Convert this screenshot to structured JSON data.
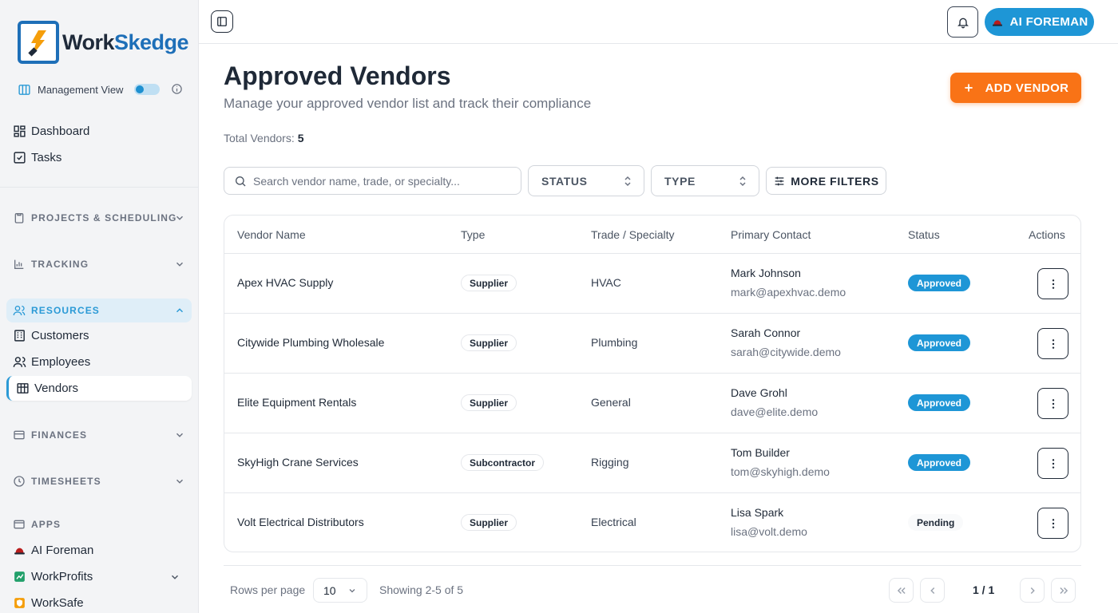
{
  "brand": {
    "name_part1": "Work",
    "name_part2": "Skedge"
  },
  "sidebar": {
    "management_view": "Management View",
    "top_items": [
      {
        "label": "Dashboard"
      },
      {
        "label": "Tasks"
      }
    ],
    "sections": {
      "projects": "PROJECTS & SCHEDULING",
      "tracking": "TRACKING",
      "resources": "RESOURCES",
      "finances": "FINANCES",
      "timesheets": "TIMESHEETS",
      "apps": "APPS"
    },
    "resources_items": [
      {
        "label": "Customers"
      },
      {
        "label": "Employees"
      },
      {
        "label": "Vendors"
      }
    ],
    "apps_items": [
      {
        "label": "AI Foreman"
      },
      {
        "label": "WorkProfits"
      },
      {
        "label": "WorkSafe"
      }
    ]
  },
  "topbar": {
    "ai_button": "AI FOREMAN"
  },
  "page": {
    "title": "Approved Vendors",
    "subtitle": "Manage your approved vendor list and track their compliance",
    "add_button": "ADD VENDOR",
    "total_label": "Total Vendors:",
    "total_value": "5"
  },
  "filters": {
    "search_placeholder": "Search vendor name, trade, or specialty...",
    "status": "STATUS",
    "type": "TYPE",
    "more": "MORE FILTERS"
  },
  "table": {
    "columns": [
      "Vendor Name",
      "Type",
      "Trade / Specialty",
      "Primary Contact",
      "Status",
      "Actions"
    ],
    "rows": [
      {
        "name": "Apex HVAC Supply",
        "type": "Supplier",
        "trade": "HVAC",
        "contact": "Mark Johnson",
        "email": "mark@apexhvac.demo",
        "status": "Approved"
      },
      {
        "name": "Citywide Plumbing Wholesale",
        "type": "Supplier",
        "trade": "Plumbing",
        "contact": "Sarah Connor",
        "email": "sarah@citywide.demo",
        "status": "Approved"
      },
      {
        "name": "Elite Equipment Rentals",
        "type": "Supplier",
        "trade": "General",
        "contact": "Dave Grohl",
        "email": "dave@elite.demo",
        "status": "Approved"
      },
      {
        "name": "SkyHigh Crane Services",
        "type": "Subcontractor",
        "trade": "Rigging",
        "contact": "Tom Builder",
        "email": "tom@skyhigh.demo",
        "status": "Approved"
      },
      {
        "name": "Volt Electrical Distributors",
        "type": "Supplier",
        "trade": "Electrical",
        "contact": "Lisa Spark",
        "email": "lisa@volt.demo",
        "status": "Pending"
      }
    ]
  },
  "pagination": {
    "rows_per_page_label": "Rows per page",
    "rows_per_page": "10",
    "showing": "Showing 2-5 of 5",
    "page": "1 / 1"
  },
  "colors": {
    "accent": "#1e96d6",
    "primary_action": "#f97316"
  },
  "icons": [
    "panel-toggle-icon",
    "bell-icon",
    "hard-hat-icon",
    "plus-icon",
    "search-icon",
    "sliders-icon",
    "kebab-icon"
  ]
}
